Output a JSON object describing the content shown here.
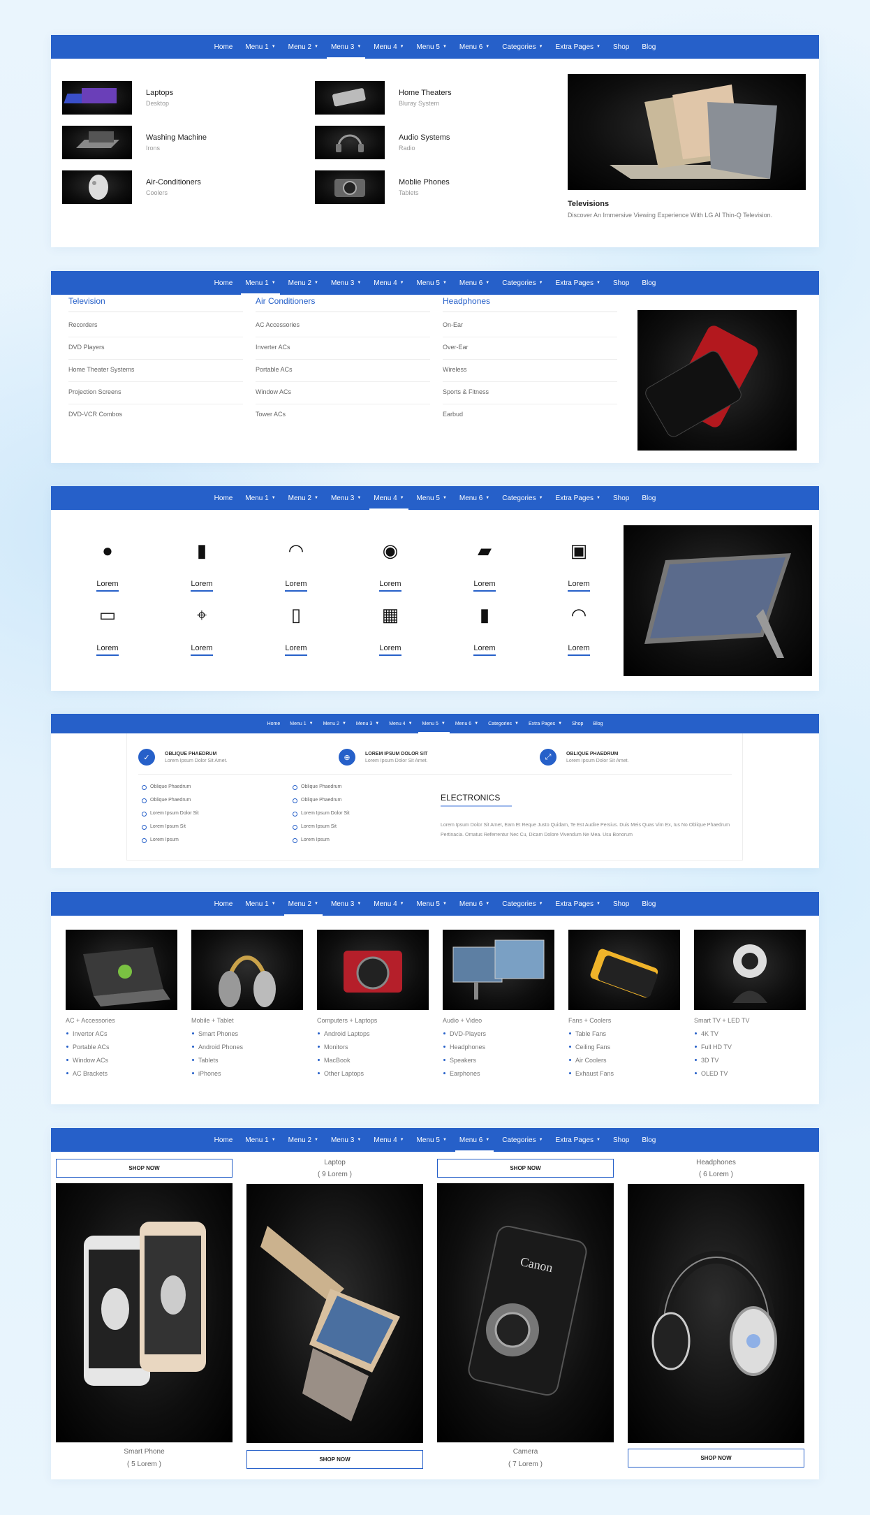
{
  "nav_items": [
    "Home",
    "Menu 1",
    "Menu 2",
    "Menu 3",
    "Menu 4",
    "Menu 5",
    "Menu 6",
    "Categories",
    "Extra Pages",
    "Shop",
    "Blog"
  ],
  "panel1": {
    "items": [
      {
        "title": "Laptops",
        "sub": "Desktop"
      },
      {
        "title": "Washing Machine",
        "sub": "Irons"
      },
      {
        "title": "Air-Conditioners",
        "sub": "Coolers"
      },
      {
        "title": "Home Theaters",
        "sub": "Bluray System"
      },
      {
        "title": "Audio Systems",
        "sub": "Radio"
      },
      {
        "title": "Moblie Phones",
        "sub": "Tablets"
      }
    ],
    "feature_title": "Televisions",
    "feature_desc": "Discover An Immersive Viewing Experience With LG AI Thin-Q Television."
  },
  "panel2": {
    "columns": [
      {
        "heading": "Television",
        "items": [
          "Recorders",
          "DVD Players",
          "Home Theater Systems",
          "Projection Screens",
          "DVD-VCR Combos"
        ]
      },
      {
        "heading": "Air Conditioners",
        "items": [
          "AC Accessories",
          "Inverter ACs",
          "Portable ACs",
          "Window ACs",
          "Tower ACs"
        ]
      },
      {
        "heading": "Headphones",
        "items": [
          "On-Ear",
          "Over-Ear",
          "Wireless",
          "Sports & Fitness",
          "Earbud"
        ]
      }
    ]
  },
  "panel3": {
    "label": "Lorem",
    "icons": [
      "speaker-icon",
      "phone-icon",
      "headphones-icon",
      "smart-speaker-icon",
      "speaker-icon",
      "smartwatch-icon",
      "camera-icon",
      "webcam-icon",
      "speaker-tall-icon",
      "action-camera-icon",
      "phone-back-icon",
      "headphones-icon"
    ]
  },
  "panel4": {
    "features": [
      {
        "title": "OBLIQUE PHAEDRUM",
        "sub": "Lorem Ipsum Dolor Sit Amet.",
        "icon": "✓"
      },
      {
        "title": "LOREM IPSUM DOLOR SIT",
        "sub": "Lorem Ipsum Dolor Sit Amet.",
        "icon": "⊕"
      },
      {
        "title": "OBLIQUE PHAEDRUM",
        "sub": "Lorem Ipsum Dolor Sit Amet.",
        "icon": "⤢"
      }
    ],
    "list1": [
      "Oblique Phaedrum",
      "Oblique Phaedrum",
      "Lorem Ipsum Dolor Sit",
      "Lorem Ipsum Sit",
      "Lorem Ipsum"
    ],
    "list2": [
      "Oblique Phaedrum",
      "Oblique Phaedrum",
      "Lorem Ipsum Dolor Sit",
      "Lorem Ipsum Sit",
      "Lorem Ipsum"
    ],
    "heading": "ELECTRONICS",
    "paragraph": "Lorem Ipsum Dolor Sit Amet, Eam Et Reque Justo Quidam, Te Est Audire Persius. Duis Meis Quas Vim Ex, Ius No Oblique Phaedrum Pertinacia. Ornatus Referrentur Nec Cu, Dicam Dolore Vivendum Ne Mea. Usu Bonorum"
  },
  "panel5": {
    "categories": [
      {
        "heading": "AC + Accessories",
        "items": [
          "Invertor ACs",
          "Portable ACs",
          "Window ACs",
          "AC Brackets"
        ]
      },
      {
        "heading": "Mobile + Tablet",
        "items": [
          "Smart Phones",
          "Android Phones",
          "Tablets",
          "iPhones"
        ]
      },
      {
        "heading": "Computers + Laptops",
        "items": [
          "Android Laptops",
          "Monitors",
          "MacBook",
          "Other Laptops"
        ]
      },
      {
        "heading": "Audio + Video",
        "items": [
          "DVD-Players",
          "Headphones",
          "Speakers",
          "Earphones"
        ]
      },
      {
        "heading": "Fans + Coolers",
        "items": [
          "Table Fans",
          "Ceiling Fans",
          "Air Coolers",
          "Exhaust Fans"
        ]
      },
      {
        "heading": "Smart TV + LED TV",
        "items": [
          "4K TV",
          "Full HD TV",
          "3D TV",
          "OLED TV"
        ]
      }
    ]
  },
  "panel6": {
    "shop_label": "SHOP NOW",
    "products": [
      {
        "name": "Smart Phone",
        "count": "( 5 Lorem )"
      },
      {
        "name": "Laptop",
        "count": "( 9 Lorem )"
      },
      {
        "name": "Camera",
        "count": "( 7 Lorem )"
      },
      {
        "name": "Headphones",
        "count": "( 6 Lorem )"
      }
    ]
  },
  "colors": {
    "accent": "#2660c9",
    "background": "#e6f3fd"
  }
}
